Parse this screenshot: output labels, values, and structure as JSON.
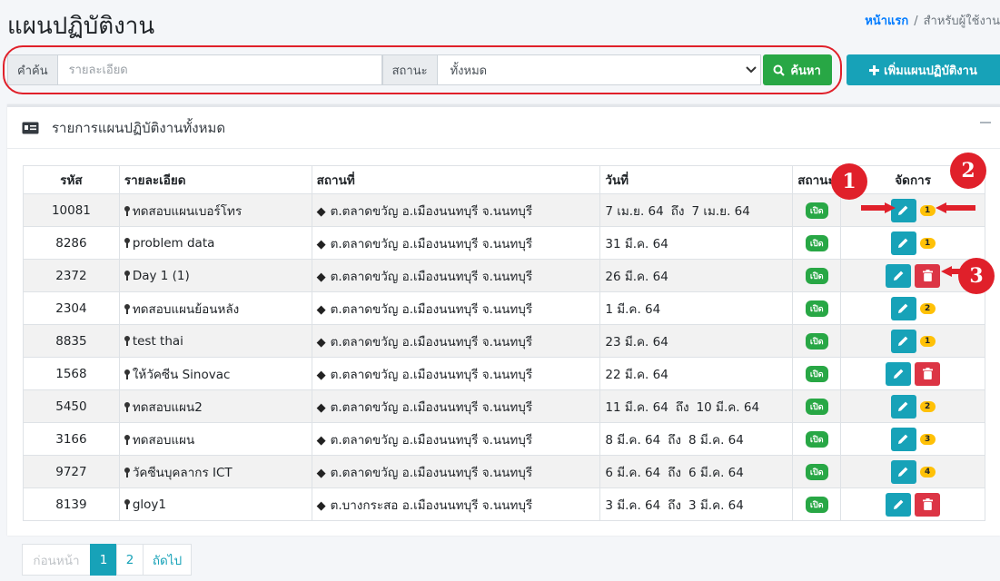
{
  "header": {
    "title": "แผนปฏิบัติงาน",
    "breadcrumb_home": "หน้าแรก",
    "breadcrumb_sep": "/",
    "breadcrumb_current": "สำหรับผู้ใช้งาน"
  },
  "search": {
    "keyword_label": "คำค้น",
    "keyword_placeholder": "รายละเอียด",
    "status_label": "สถานะ",
    "status_value": "ทั้งหมด",
    "search_button": "ค้นหา"
  },
  "add_button": "เพิ่มแผนปฏิบัติงาน",
  "card": {
    "title": "รายการแผนปฏิบัติงานทั้งหมด"
  },
  "table": {
    "headers": [
      "รหัส",
      "รายละเอียด",
      "สถานที่",
      "วันที่",
      "สถานะ",
      "จัดการ"
    ],
    "date_sep": "ถึง",
    "status_text": "เปิด",
    "rows": [
      {
        "code": "10081",
        "detail": "ทดสอบแผนเบอร์โทร",
        "place": "ต.ตลาดขวัญ อ.เมืองนนทบุรี จ.นนทบุรี",
        "date_from": "7 เม.ย. 64",
        "date_to": "7 เม.ย. 64",
        "delete": false,
        "count": "1"
      },
      {
        "code": "8286",
        "detail": "problem data",
        "place": "ต.ตลาดขวัญ อ.เมืองนนทบุรี จ.นนทบุรี",
        "date_from": "31 มี.ค. 64",
        "date_to": "",
        "delete": false,
        "count": "1"
      },
      {
        "code": "2372",
        "detail": "Day 1 (1)",
        "place": "ต.ตลาดขวัญ อ.เมืองนนทบุรี จ.นนทบุรี",
        "date_from": "26 มี.ค. 64",
        "date_to": "",
        "delete": true,
        "count": ""
      },
      {
        "code": "2304",
        "detail": "ทดสอบแผนย้อนหลัง",
        "place": "ต.ตลาดขวัญ อ.เมืองนนทบุรี จ.นนทบุรี",
        "date_from": "1 มี.ค. 64",
        "date_to": "",
        "delete": false,
        "count": "2"
      },
      {
        "code": "8835",
        "detail": "test thai",
        "place": "ต.ตลาดขวัญ อ.เมืองนนทบุรี จ.นนทบุรี",
        "date_from": "23 มี.ค. 64",
        "date_to": "",
        "delete": false,
        "count": "1"
      },
      {
        "code": "1568",
        "detail": "ให้วัคซีน Sinovac",
        "place": "ต.ตลาดขวัญ อ.เมืองนนทบุรี จ.นนทบุรี",
        "date_from": "22 มี.ค. 64",
        "date_to": "",
        "delete": true,
        "count": ""
      },
      {
        "code": "5450",
        "detail": "ทดสอบแผน2",
        "place": "ต.ตลาดขวัญ อ.เมืองนนทบุรี จ.นนทบุรี",
        "date_from": "11 มี.ค. 64",
        "date_to": "10 มี.ค. 64",
        "delete": false,
        "count": "2"
      },
      {
        "code": "3166",
        "detail": "ทดสอบแผน",
        "place": "ต.ตลาดขวัญ อ.เมืองนนทบุรี จ.นนทบุรี",
        "date_from": "8 มี.ค. 64",
        "date_to": "8 มี.ค. 64",
        "delete": false,
        "count": "3"
      },
      {
        "code": "9727",
        "detail": "วัคซีนบุคลากร ICT",
        "place": "ต.ตลาดขวัญ อ.เมืองนนทบุรี จ.นนทบุรี",
        "date_from": "6 มี.ค. 64",
        "date_to": "6 มี.ค. 64",
        "delete": false,
        "count": "4"
      },
      {
        "code": "8139",
        "detail": "gloy1",
        "place": "ต.บางกระสอ อ.เมืองนนทบุรี จ.นนทบุรี",
        "date_from": "3 มี.ค. 64",
        "date_to": "3 มี.ค. 64",
        "delete": true,
        "count": ""
      }
    ]
  },
  "pagination": {
    "prev": "ก่อนหน้า",
    "pages": [
      "1",
      "2"
    ],
    "next": "ถัดไป"
  },
  "annotations": [
    "1",
    "2",
    "3"
  ],
  "colors": {
    "primary_teal": "#17a2b8",
    "success_green": "#28a745",
    "danger_red": "#dc3545",
    "warning_yellow": "#ffc107",
    "annotation_red": "#e0202a"
  }
}
